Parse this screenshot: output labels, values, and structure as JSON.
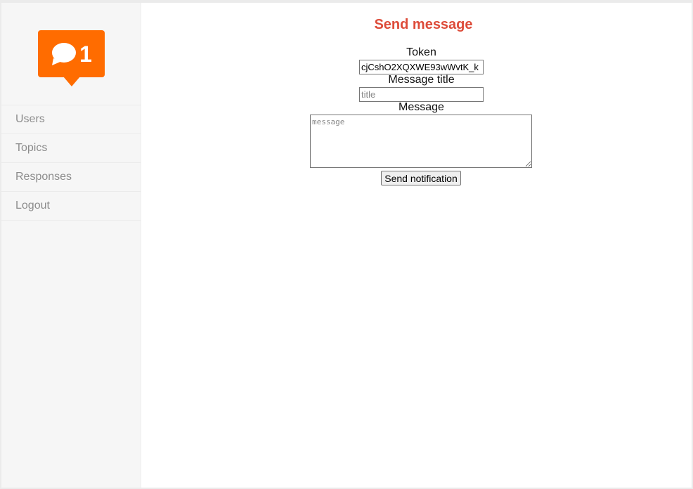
{
  "sidebar": {
    "logo": {
      "icon": "chat-bubble-icon",
      "badge_count": "1",
      "color": "#ff6c00"
    },
    "items": [
      {
        "label": "Users"
      },
      {
        "label": "Topics"
      },
      {
        "label": "Responses"
      },
      {
        "label": "Logout"
      }
    ]
  },
  "main": {
    "title": "Send message",
    "title_color": "#dd4b39",
    "token": {
      "label": "Token",
      "value": "cjCshO2XQXWE93wWvtK_k"
    },
    "message_title": {
      "label": "Message title",
      "placeholder": "title"
    },
    "message": {
      "label": "Message",
      "placeholder": "message"
    },
    "submit_label": "Send notification"
  }
}
